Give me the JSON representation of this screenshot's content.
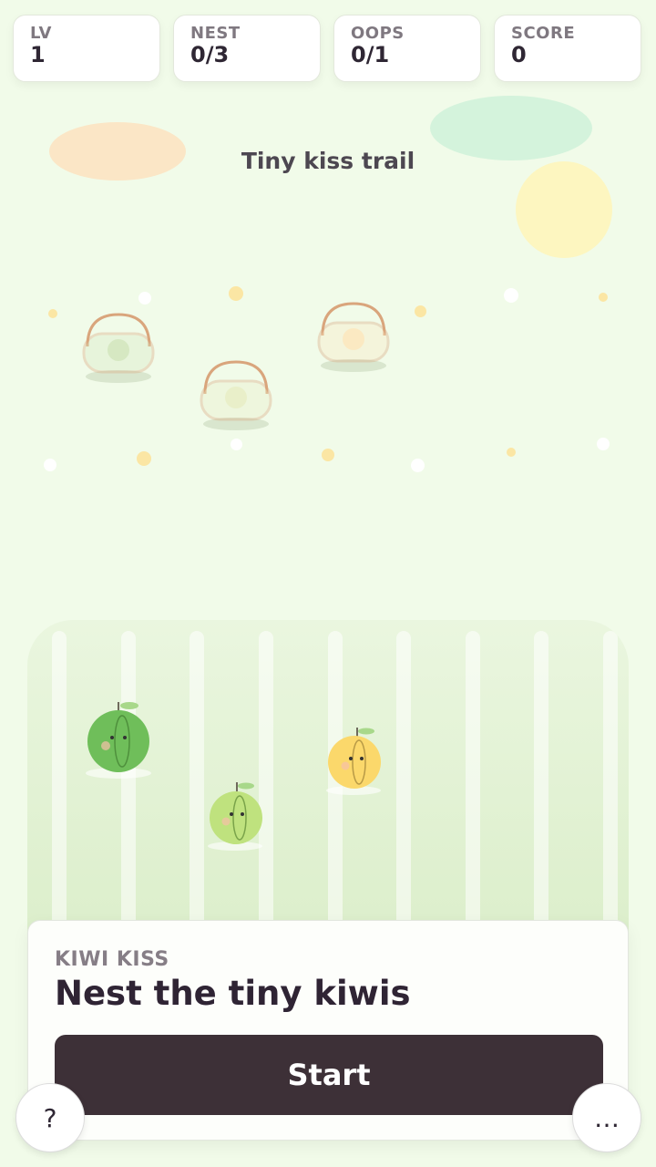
{
  "hud": {
    "level": {
      "label": "LV",
      "value": "1"
    },
    "nest": {
      "label": "NEST",
      "value": "0/3"
    },
    "oops": {
      "label": "OOPS",
      "value": "0/1"
    },
    "score": {
      "label": "SCORE",
      "value": "0"
    }
  },
  "level_title": "Tiny kiss trail",
  "baskets": [
    {
      "name": "basket-1",
      "fill_color": "#d6e8c2"
    },
    {
      "name": "basket-2",
      "fill_color": "#e9efc9"
    },
    {
      "name": "basket-3",
      "fill_color": "#fbe9c2"
    }
  ],
  "fruits": [
    {
      "name": "green-apple",
      "color": "#6fbe5a"
    },
    {
      "name": "lime-kiwi",
      "color": "#bfe27e"
    },
    {
      "name": "yellow-kiwi",
      "color": "#fbd86b"
    }
  ],
  "panel": {
    "kicker": "KIWI KISS",
    "heading": "Nest the tiny kiwis",
    "start_label": "Start"
  },
  "help_button": {
    "label": "?"
  },
  "more_button": {
    "label": "…"
  }
}
